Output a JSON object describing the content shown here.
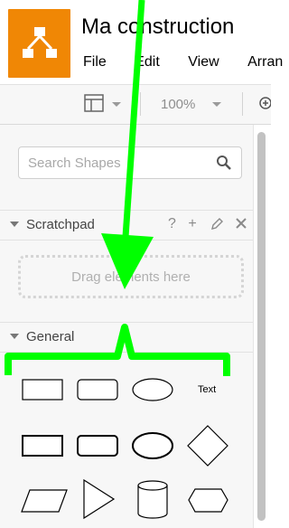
{
  "app": {
    "title": "Ma construction",
    "menu": [
      "File",
      "Edit",
      "View",
      "Arran"
    ]
  },
  "toolbar": {
    "zoom": "100%"
  },
  "sidebar": {
    "search_placeholder": "Search Shapes",
    "scratchpad": {
      "label": "Scratchpad",
      "icons": [
        "?",
        "+"
      ],
      "dropzone_text": "Drag elements here"
    },
    "general": {
      "label": "General",
      "text_shape_label": "Text"
    }
  },
  "colors": {
    "brand": "#f08705",
    "annotation": "#00ff00"
  }
}
